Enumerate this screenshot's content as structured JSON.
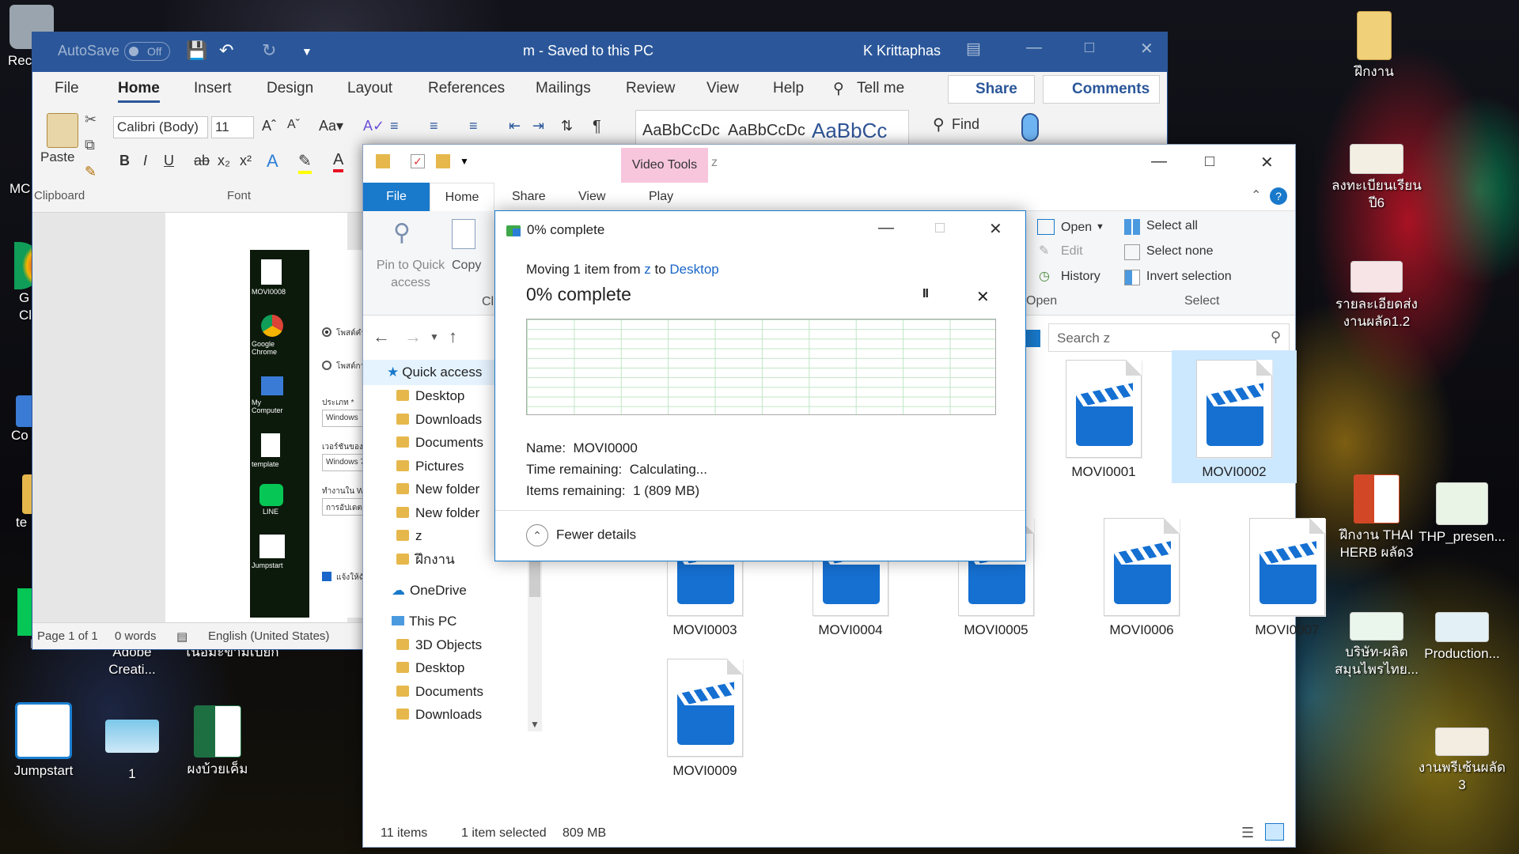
{
  "desktop": {
    "icons_left": [
      {
        "label": "Rec"
      },
      {
        "label": "MC"
      },
      {
        "label": "G\nCl"
      },
      {
        "label": "Co"
      },
      {
        "label": "te"
      },
      {
        "label": "LINE"
      },
      {
        "label": "Adobe\nCreati..."
      },
      {
        "label": "เนื้อมะขามเปียก"
      },
      {
        "label": "Jumpstart"
      },
      {
        "label": "1"
      },
      {
        "label": "ผงบ้วยเค็ม"
      }
    ],
    "icons_right": [
      {
        "label": "ฝึกงาน"
      },
      {
        "label": "ลงทะเบียนเรียน\nปี6"
      },
      {
        "label": "รายละเอียดส่ง\nงานผลัด1.2"
      },
      {
        "label": "ฝึกงาน THAI\nHERB ผลัด3"
      },
      {
        "label": "THP_presen..."
      },
      {
        "label": "บริษัท-ผลิต\nสมุนไพรไทย..."
      },
      {
        "label": "Production..."
      },
      {
        "label": "งานพรีเซ้นผลัด\n3"
      }
    ]
  },
  "word": {
    "autosave": "AutoSave",
    "autosave_state": "Off",
    "doc_title": "m  -  Saved to this PC",
    "user": "K Krittaphas",
    "tabs": [
      "File",
      "Home",
      "Insert",
      "Design",
      "Layout",
      "References",
      "Mailings",
      "Review",
      "View",
      "Help",
      "Tell me"
    ],
    "share": "Share",
    "comments": "Comments",
    "ribbon": {
      "paste": "Paste",
      "clipboard": "Clipboard",
      "font_name": "Calibri (Body)",
      "font_size": "11",
      "font_group": "Font",
      "style1": "AaBbCcDc",
      "style2": "AaBbCcDc",
      "style3": "AaBbCc",
      "find": "Find"
    },
    "status": {
      "page": "Page 1 of 1",
      "words": "0 words",
      "language": "English (United States)"
    },
    "embedded": {
      "labels": [
        "MOVI0008",
        "Google Chrome",
        "My Computer",
        "template",
        "LINE",
        "Jumpstart"
      ],
      "form": [
        "โพสต์คำถาม",
        "โพสต์การอ",
        "ประเภท *",
        "Windows",
        "เวอร์ชันของ Windo",
        "Windows 7",
        "ทำงานใน Windows",
        "การอัปเดต การ",
        "แจ้งให้ฉันทรา"
      ]
    }
  },
  "explorer": {
    "video_tools": "Video Tools",
    "title": "z",
    "tabs": {
      "file": "File",
      "home": "Home",
      "share": "Share",
      "view": "View",
      "play": "Play"
    },
    "ribbon": {
      "pin": "Pin to Quick\naccess",
      "copy": "Copy",
      "cli": "Cli",
      "open": "Open",
      "edit": "Edit",
      "history": "History",
      "open_group": "Open",
      "select_all": "Select all",
      "select_none": "Select none",
      "invert": "Invert selection",
      "select_group": "Select"
    },
    "search_placeholder": "Search z",
    "nav": [
      {
        "label": "Quick access",
        "kind": "star"
      },
      {
        "label": "Desktop",
        "kind": "folder"
      },
      {
        "label": "Downloads",
        "kind": "folder"
      },
      {
        "label": "Documents",
        "kind": "folder"
      },
      {
        "label": "Pictures",
        "kind": "folder"
      },
      {
        "label": "New folder",
        "kind": "folder"
      },
      {
        "label": "New folder",
        "kind": "folder"
      },
      {
        "label": "z",
        "kind": "folder"
      },
      {
        "label": "ฝึกงาน",
        "kind": "folder"
      },
      {
        "label": "OneDrive",
        "kind": "cloud"
      },
      {
        "label": "This PC",
        "kind": "pc"
      },
      {
        "label": "3D Objects",
        "kind": "folder"
      },
      {
        "label": "Desktop",
        "kind": "folder"
      },
      {
        "label": "Documents",
        "kind": "folder"
      },
      {
        "label": "Downloads",
        "kind": "folder"
      }
    ],
    "files": [
      {
        "name": "MOVI0001",
        "selected": false
      },
      {
        "name": "MOVI0002",
        "selected": true
      },
      {
        "name": "MOVI0003",
        "selected": false
      },
      {
        "name": "MOVI0004",
        "selected": false
      },
      {
        "name": "MOVI0005",
        "selected": false
      },
      {
        "name": "MOVI0006",
        "selected": false
      },
      {
        "name": "MOVI0007",
        "selected": false
      },
      {
        "name": "MOVI0009",
        "selected": false
      }
    ],
    "status": {
      "items": "11 items",
      "selected": "1 item selected",
      "size": "809 MB"
    }
  },
  "progress": {
    "title": "0% complete",
    "moving_prefix": "Moving 1 item from ",
    "source": "z",
    "moving_mid": " to ",
    "dest": "Desktop",
    "percent": "0% complete",
    "pause": "II",
    "cancel": "✕",
    "name_label": "Name:",
    "name_value": "MOVI0000",
    "time_label": "Time remaining:",
    "time_value": "Calculating...",
    "items_label": "Items remaining:",
    "items_value": "1 (809 MB)",
    "fewer": "Fewer details"
  },
  "colors": {
    "word_blue": "#2b579a",
    "explorer_accent": "#1979ca",
    "video_tools_bg": "#f7c6dd",
    "graph_grid": "#bfe6c4",
    "clapper": "#1570d2"
  }
}
